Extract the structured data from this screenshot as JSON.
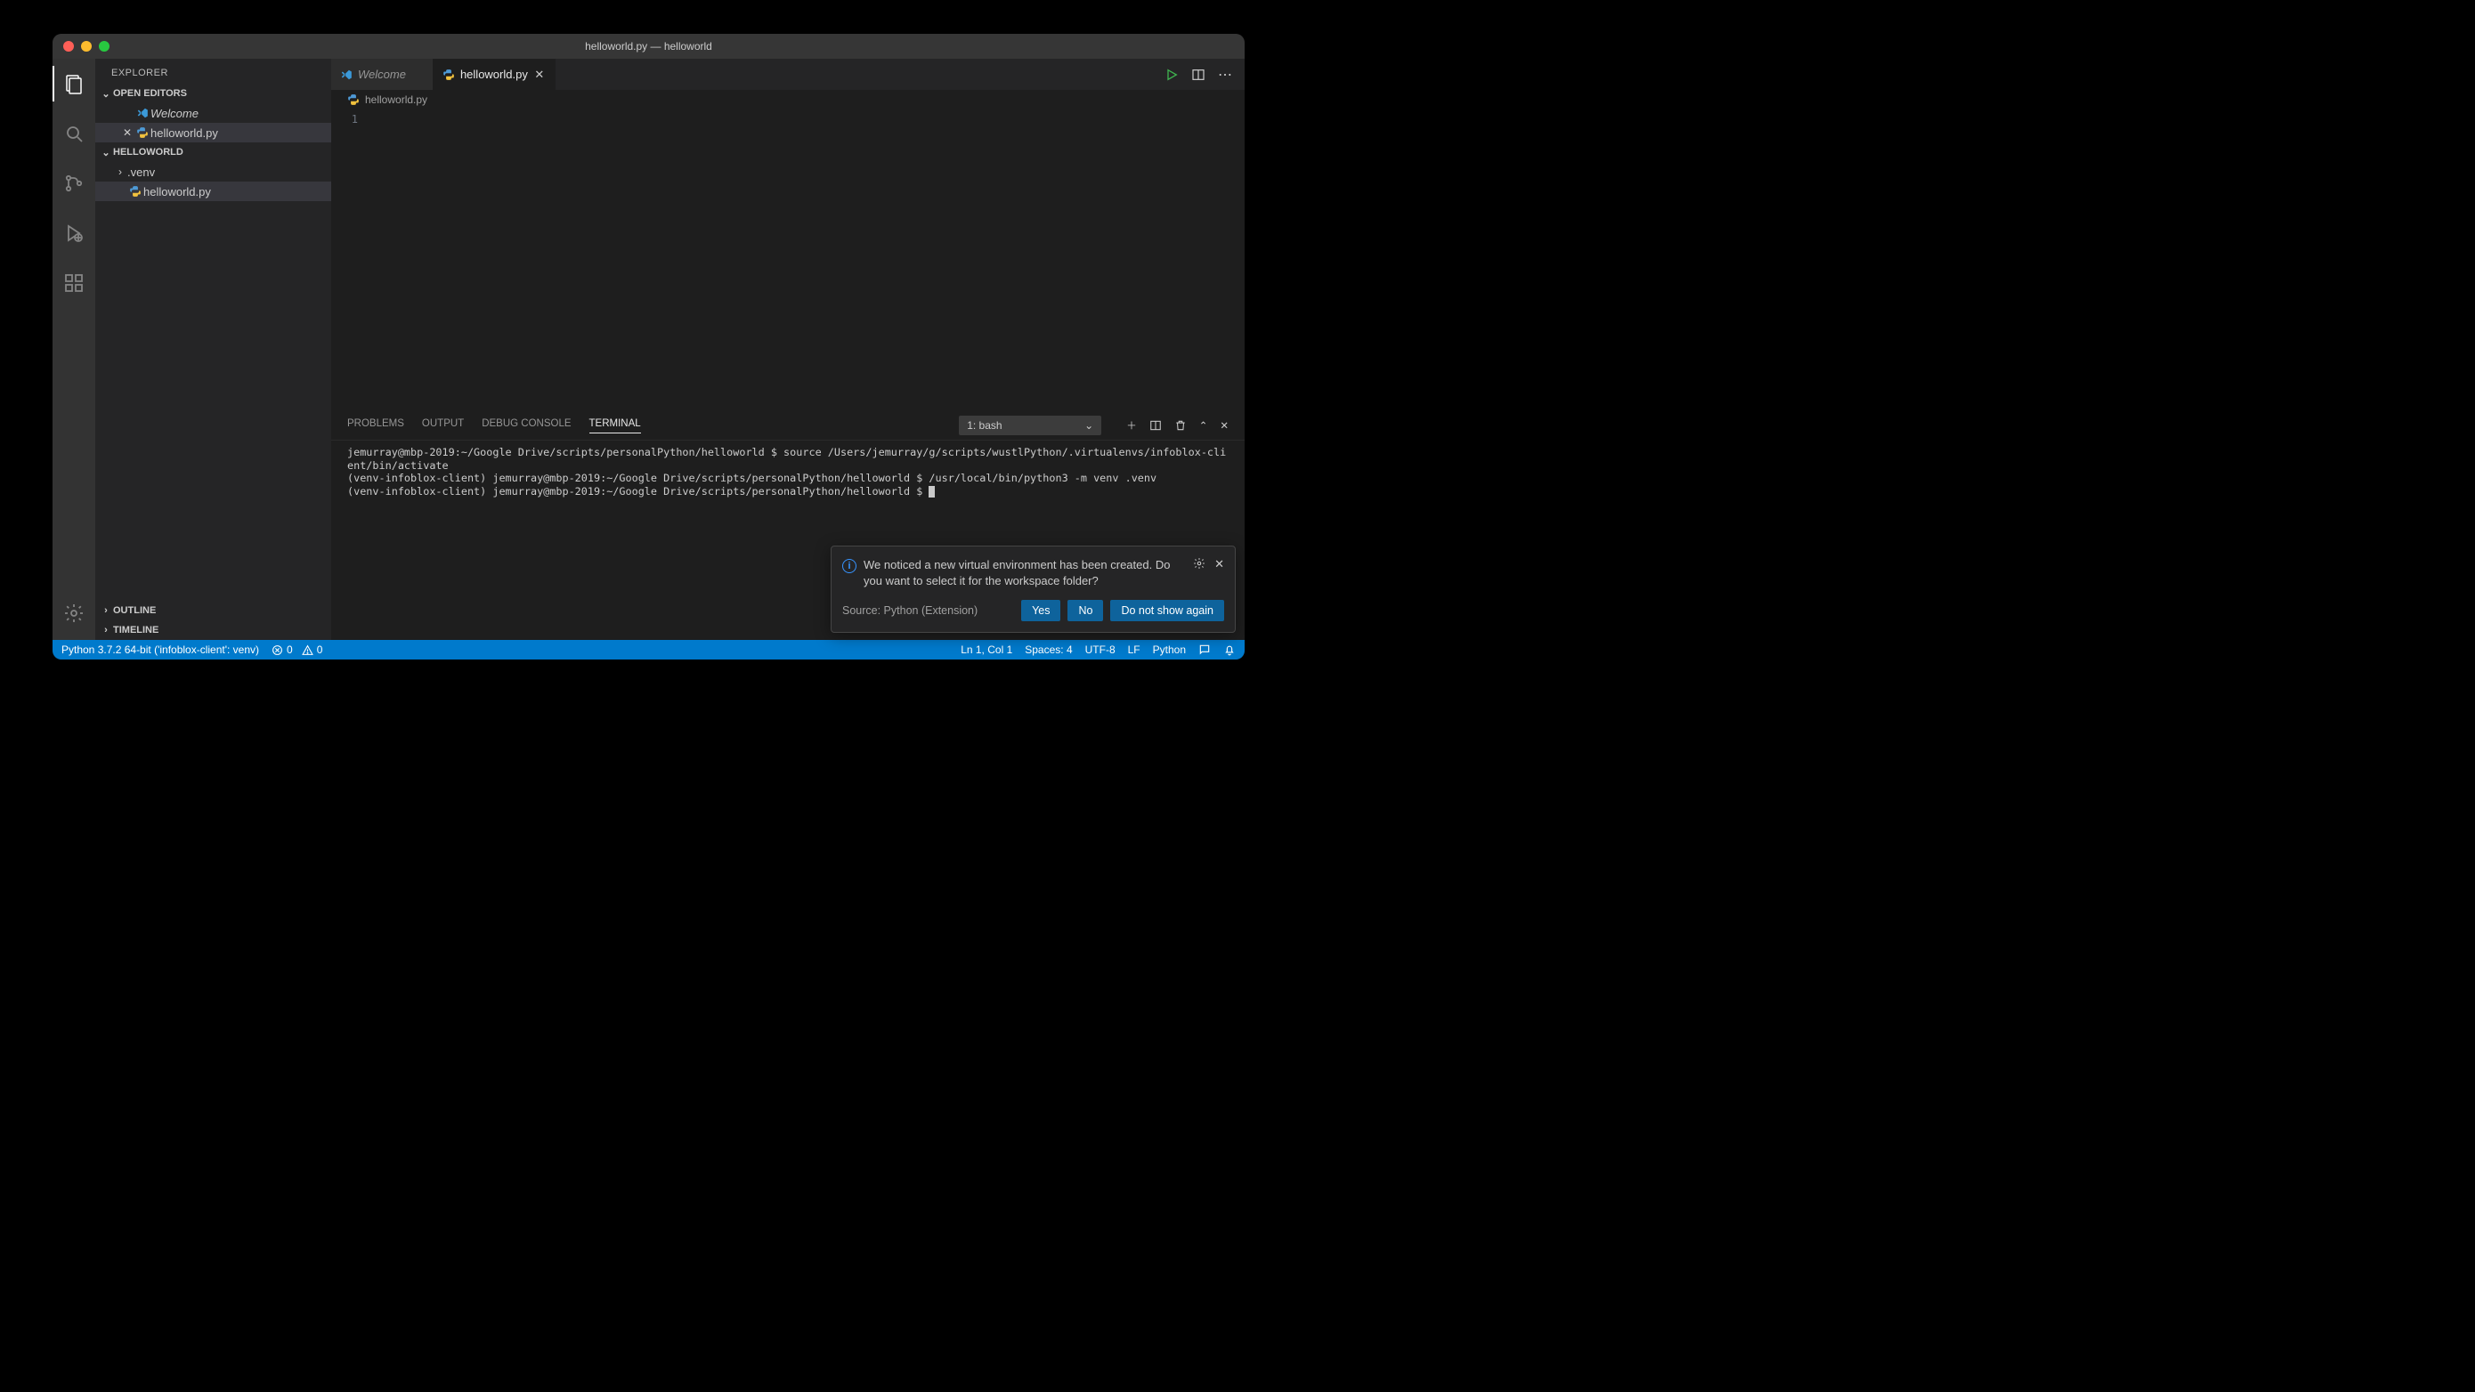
{
  "window": {
    "title": "helloworld.py — helloworld"
  },
  "sidebar": {
    "title": "EXPLORER",
    "sections": {
      "openEditors": "OPEN EDITORS",
      "workspace": "HELLOWORLD",
      "outline": "OUTLINE",
      "timeline": "TIMELINE"
    },
    "openEditorItems": [
      {
        "label": "Welcome",
        "italic": true,
        "icon": "vscode"
      },
      {
        "label": "helloworld.py",
        "italic": false,
        "icon": "python",
        "closeable": true,
        "selected": true
      }
    ],
    "workspaceItems": [
      {
        "label": ".venv",
        "type": "folder"
      },
      {
        "label": "helloworld.py",
        "type": "file",
        "icon": "python",
        "selected": true
      }
    ]
  },
  "tabs": [
    {
      "label": "Welcome",
      "italic": true,
      "icon": "vscode",
      "active": false
    },
    {
      "label": "helloworld.py",
      "italic": false,
      "icon": "python",
      "active": true
    }
  ],
  "breadcrumb": {
    "file": "helloworld.py",
    "icon": "python"
  },
  "editor": {
    "lineNumbers": [
      "1"
    ],
    "content": ""
  },
  "panel": {
    "tabs": [
      "PROBLEMS",
      "OUTPUT",
      "DEBUG CONSOLE",
      "TERMINAL"
    ],
    "activeTab": "TERMINAL",
    "termSelector": "1: bash",
    "terminalLines": [
      "jemurray@mbp-2019:~/Google Drive/scripts/personalPython/helloworld $ source /Users/jemurray/g/scripts/wustlPython/.virtualenvs/infoblox-client/bin/activate",
      "(venv-infoblox-client) jemurray@mbp-2019:~/Google Drive/scripts/personalPython/helloworld $ /usr/local/bin/python3 -m venv .venv",
      "(venv-infoblox-client) jemurray@mbp-2019:~/Google Drive/scripts/personalPython/helloworld $ "
    ]
  },
  "notification": {
    "message": "We noticed a new virtual environment has been created. Do you want to select it for the workspace folder?",
    "source": "Source: Python (Extension)",
    "buttons": {
      "yes": "Yes",
      "no": "No",
      "dismiss": "Do not show again"
    }
  },
  "status": {
    "python": "Python 3.7.2 64-bit ('infoblox-client': venv)",
    "errors": "0",
    "warnings": "0",
    "cursor": "Ln 1, Col 1",
    "spaces": "Spaces: 4",
    "encoding": "UTF-8",
    "eol": "LF",
    "language": "Python"
  },
  "colors": {
    "accent": "#007acc"
  }
}
